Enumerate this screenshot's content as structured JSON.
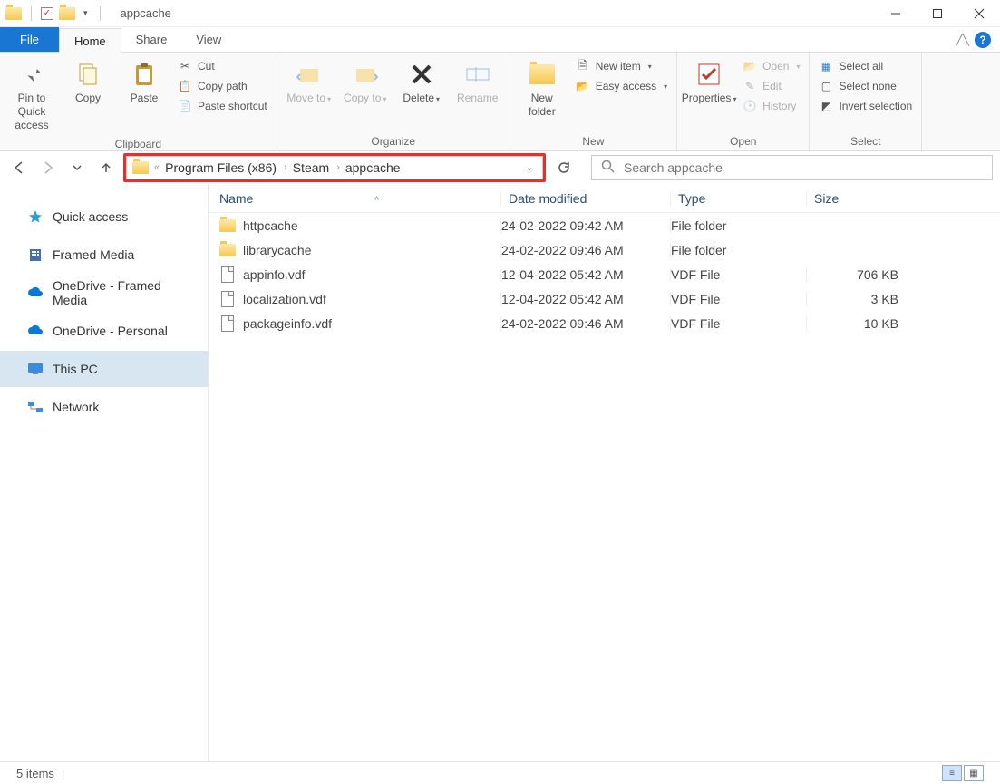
{
  "title": "appcache",
  "tabs": {
    "file": "File",
    "home": "Home",
    "share": "Share",
    "view": "View"
  },
  "ribbon": {
    "clipboard": {
      "label": "Clipboard",
      "pin": "Pin to Quick access",
      "copy": "Copy",
      "paste": "Paste",
      "cut": "Cut",
      "copypath": "Copy path",
      "pasteshortcut": "Paste shortcut"
    },
    "organize": {
      "label": "Organize",
      "moveto": "Move to",
      "copyto": "Copy to",
      "delete": "Delete",
      "rename": "Rename"
    },
    "new": {
      "label": "New",
      "newfolder": "New folder",
      "newitem": "New item",
      "easyaccess": "Easy access"
    },
    "open": {
      "label": "Open",
      "properties": "Properties",
      "open": "Open",
      "edit": "Edit",
      "history": "History"
    },
    "select": {
      "label": "Select",
      "selectall": "Select all",
      "selectnone": "Select none",
      "invert": "Invert selection"
    }
  },
  "breadcrumbs": [
    "Program Files (x86)",
    "Steam",
    "appcache"
  ],
  "search_placeholder": "Search appcache",
  "sidebar": [
    {
      "label": "Quick access",
      "icon": "star"
    },
    {
      "label": "Framed Media",
      "icon": "building"
    },
    {
      "label": "OneDrive - Framed Media",
      "icon": "cloud"
    },
    {
      "label": "OneDrive - Personal",
      "icon": "cloud"
    },
    {
      "label": "This PC",
      "icon": "pc",
      "selected": true
    },
    {
      "label": "Network",
      "icon": "network"
    }
  ],
  "columns": {
    "name": "Name",
    "date": "Date modified",
    "type": "Type",
    "size": "Size"
  },
  "files": [
    {
      "name": "httpcache",
      "date": "24-02-2022 09:42 AM",
      "type": "File folder",
      "size": "",
      "icon": "folder"
    },
    {
      "name": "librarycache",
      "date": "24-02-2022 09:46 AM",
      "type": "File folder",
      "size": "",
      "icon": "folder"
    },
    {
      "name": "appinfo.vdf",
      "date": "12-04-2022 05:42 AM",
      "type": "VDF File",
      "size": "706 KB",
      "icon": "file"
    },
    {
      "name": "localization.vdf",
      "date": "12-04-2022 05:42 AM",
      "type": "VDF File",
      "size": "3 KB",
      "icon": "file"
    },
    {
      "name": "packageinfo.vdf",
      "date": "24-02-2022 09:46 AM",
      "type": "VDF File",
      "size": "10 KB",
      "icon": "file"
    }
  ],
  "status": "5 items"
}
